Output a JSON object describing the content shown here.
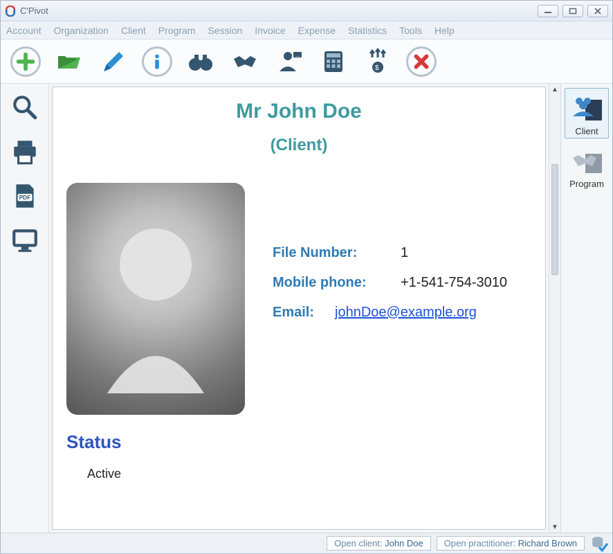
{
  "window": {
    "title": "C'Pivot"
  },
  "menu": {
    "items": [
      "Account",
      "Organization",
      "Client",
      "Program",
      "Session",
      "Invoice",
      "Expense",
      "Statistics",
      "Tools",
      "Help"
    ]
  },
  "sidebar_right": {
    "tabs": [
      {
        "label": "Client",
        "icon": "people-icon",
        "selected": true
      },
      {
        "label": "Program",
        "icon": "handshake-icon",
        "selected": false
      }
    ]
  },
  "client": {
    "display_name": "Mr John Doe",
    "role_label": "(Client)",
    "fields": {
      "file_number_label": "File Number:",
      "file_number_value": "1",
      "mobile_label": "Mobile phone:",
      "mobile_value": "+1-541-754-3010",
      "email_label": "Email:",
      "email_value": "johnDoe@example.org"
    },
    "status_header": "Status",
    "status_value": "Active"
  },
  "statusbar": {
    "open_client_label": "Open client:",
    "open_client_value": "John Doe",
    "open_practitioner_label": "Open practitioner:",
    "open_practitioner_value": "Richard Brown"
  }
}
